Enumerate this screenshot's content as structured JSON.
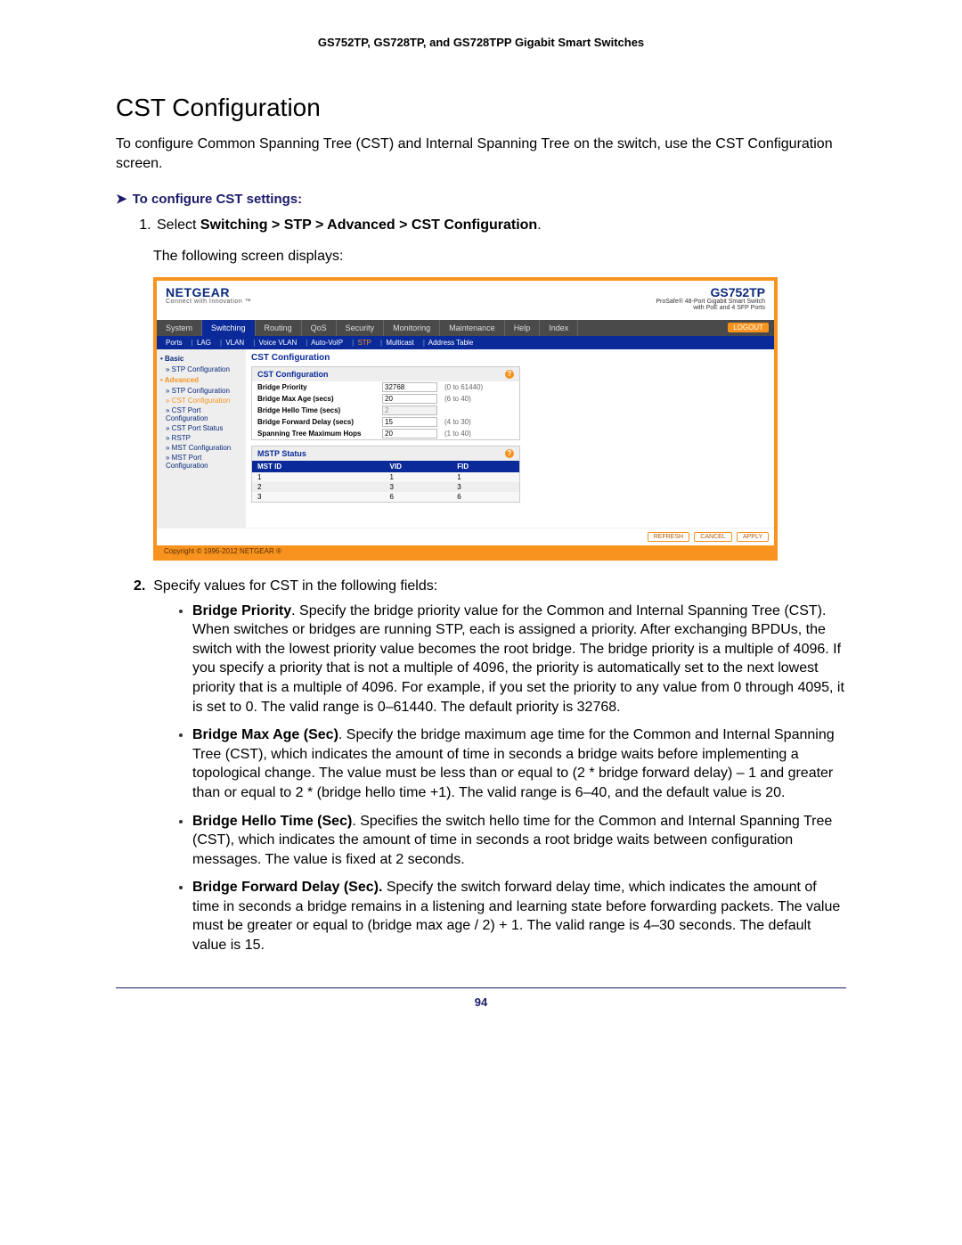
{
  "header": "GS752TP, GS728TP, and GS728TPP Gigabit Smart Switches",
  "title": "CST Configuration",
  "intro": "To configure Common Spanning Tree (CST) and Internal Spanning Tree on the switch, use the CST Configuration screen.",
  "proc_head": "To configure CST settings:",
  "step1_prefix": "Select ",
  "step1_path": "Switching > STP > Advanced > CST Configuration",
  "step1_suffix": ".",
  "following": "The following screen displays:",
  "fig": {
    "brand": "NETGEAR",
    "brand_tag": "Connect with Innovation ™",
    "model": "GS752TP",
    "model_tag1": "ProSafe® 48-Port Gigabit Smart Switch",
    "model_tag2": "with PoE and 4 SFP Ports",
    "tabs": [
      "System",
      "Switching",
      "Routing",
      "QoS",
      "Security",
      "Monitoring",
      "Maintenance",
      "Help",
      "Index"
    ],
    "active_tab": "Switching",
    "logout": "LOGOUT",
    "subtabs": [
      "Ports",
      "LAG",
      "VLAN",
      "Voice VLAN",
      "Auto-VoIP",
      "STP",
      "Multicast",
      "Address Table"
    ],
    "subtab_active": "STP",
    "side": {
      "basic": "Basic",
      "stp_cfg": "STP Configuration",
      "advanced": "Advanced",
      "stp_cfg2": "STP Configuration",
      "cst_cfg": "CST Configuration",
      "cst_port": "CST Port Configuration",
      "cst_port_status": "CST Port Status",
      "rstp": "RSTP",
      "mst_cfg": "MST Configuration",
      "mst_port": "MST Port Configuration"
    },
    "panel_head": "CST Configuration",
    "cfg_title": "CST Configuration",
    "rows": [
      {
        "lbl": "Bridge Priority",
        "val": "32768",
        "range": "(0 to 61440)",
        "ro": false
      },
      {
        "lbl": "Bridge Max Age (secs)",
        "val": "20",
        "range": "(6 to 40)",
        "ro": false
      },
      {
        "lbl": "Bridge Hello Time (secs)",
        "val": "2",
        "range": "",
        "ro": true
      },
      {
        "lbl": "Bridge Forward Delay (secs)",
        "val": "15",
        "range": "(4 to 30)",
        "ro": false
      },
      {
        "lbl": "Spanning Tree Maximum Hops",
        "val": "20",
        "range": "(1 to 40)",
        "ro": false
      }
    ],
    "mstp_title": "MSTP Status",
    "mstp_head": [
      "MST ID",
      "VID",
      "FID"
    ],
    "mstp_rows": [
      [
        "1",
        "1",
        "1"
      ],
      [
        "2",
        "3",
        "3"
      ],
      [
        "3",
        "6",
        "6"
      ]
    ],
    "buttons": [
      "REFRESH",
      "CANCEL",
      "APPLY"
    ],
    "copyright": "Copyright © 1996-2012 NETGEAR ®"
  },
  "step2": "Specify values for CST in the following fields:",
  "bullets": [
    {
      "h": "Bridge Priority",
      "t": ". Specify the bridge priority value for the Common and Internal Spanning Tree (CST). When switches or bridges are running STP, each is assigned a priority. After exchanging BPDUs, the switch with the lowest priority value becomes the root bridge. The bridge priority is a multiple of 4096. If you specify a priority that is not a multiple of 4096, the priority is automatically set to the next lowest priority that is a multiple of 4096. For example, if you set the priority to any value from 0 through 4095, it is set to 0. The valid range is 0–61440. The default priority is 32768."
    },
    {
      "h": "Bridge Max Age (Sec)",
      "t": ". Specify the bridge maximum age time for the Common and Internal Spanning Tree (CST), which indicates the amount of time in seconds a bridge waits before implementing a topological change. The value must be less than or equal to (2 * bridge forward delay) – 1 and greater than or equal to 2 * (bridge hello time +1). The valid range is 6–40, and the default value is 20."
    },
    {
      "h": "Bridge Hello Time (Sec)",
      "t": ". Specifies the switch hello time for the Common and Internal Spanning Tree (CST), which indicates the amount of time in seconds a root bridge waits between configuration messages. The value is fixed at 2 seconds."
    },
    {
      "h": "Bridge Forward Delay (Sec).",
      "t": " Specify the switch forward delay time, which indicates the amount of time in seconds a bridge remains in a listening and learning state before forwarding packets. The value must be greater or equal to (bridge max age / 2) + 1. The valid range is 4–30 seconds. The default value is 15."
    }
  ],
  "page_num": "94"
}
